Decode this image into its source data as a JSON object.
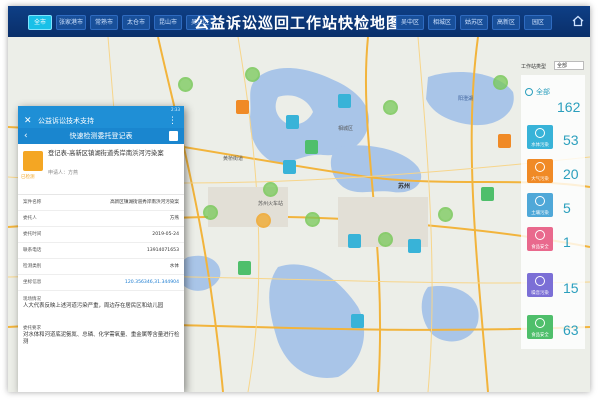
{
  "header": {
    "title": "公益诉讼巡回工作站快检地图",
    "tabs": [
      {
        "label": "全市",
        "active": true
      },
      {
        "label": "张家港市",
        "active": false
      },
      {
        "label": "常熟市",
        "active": false
      },
      {
        "label": "太仓市",
        "active": false
      },
      {
        "label": "昆山市",
        "active": false
      },
      {
        "label": "吴江区",
        "active": false
      },
      {
        "label": "吴中区",
        "active": false
      },
      {
        "label": "相城区",
        "active": false
      },
      {
        "label": "姑苏区",
        "active": false
      },
      {
        "label": "高新区",
        "active": false
      },
      {
        "label": "园区",
        "active": false
      }
    ]
  },
  "phone": {
    "status_time": "2:33",
    "app_title": "公益诉讼技术支持",
    "subtitle": "快速检测委托登记表",
    "case": {
      "title": "登记表-高新区镇湖街道秀岸南浜河污染案",
      "applicant": "申请人：方燕",
      "avatar_caption": "已检测"
    },
    "fields": [
      {
        "key": "案件名称",
        "value": "高新区镇湖街道秀岸南浜河污染案"
      },
      {
        "key": "委托人",
        "value": "方燕"
      },
      {
        "key": "委托时间",
        "value": "2019-05-24"
      },
      {
        "key": "联系电话",
        "value": "13914071653"
      },
      {
        "key": "检测类别",
        "value": "水体"
      },
      {
        "key": "坐标信息",
        "value": "120.356346,31.344904"
      }
    ],
    "sections": [
      {
        "label": "现场情况",
        "text": "人大代表反映上述河道污染严重，周边存在居民区和幼儿园"
      },
      {
        "label": "委托要求",
        "text": "对水体和河道底泥氨氮、总磷、化学需氧量、重金属等含量进行检测"
      }
    ]
  },
  "right": {
    "type_label": "工作站类型",
    "select_value": "全部",
    "all_label": "全部",
    "all_count": "162",
    "categories": [
      {
        "label": "水体污染",
        "count": "53",
        "color": "#38b3d8"
      },
      {
        "label": "大气污染",
        "count": "20",
        "color": "#f08a26"
      },
      {
        "label": "土壤污染",
        "count": "5",
        "color": "#4fa8d8"
      },
      {
        "label": "食品安全",
        "count": "1",
        "color": "#e9698d"
      },
      {
        "label": "噪音污染",
        "count": "15",
        "color": "#7b6fd6"
      },
      {
        "label": "食品安全",
        "count": "63",
        "color": "#4fbf6b"
      }
    ]
  },
  "map_labels": {
    "a": "苏州火车站",
    "b": "苏州",
    "c": "黄桥街道",
    "d": "相城区",
    "e": "阳澄湖"
  }
}
